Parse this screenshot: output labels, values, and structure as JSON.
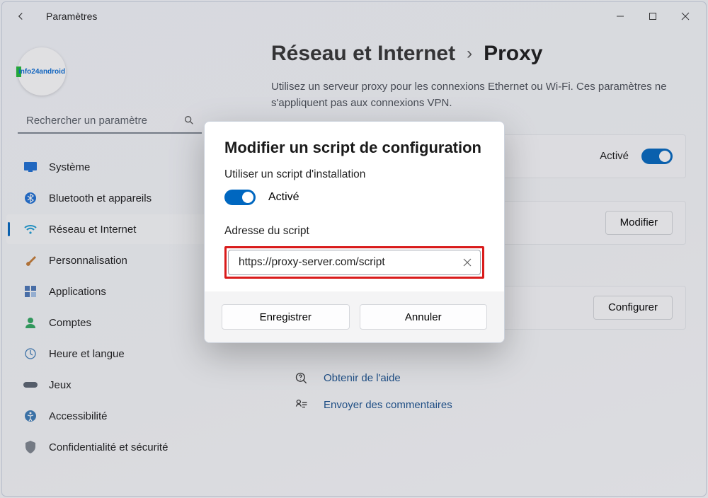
{
  "titlebar": {
    "title": "Paramètres"
  },
  "avatar_logo_text": "info24android",
  "search": {
    "placeholder": "Rechercher un paramètre"
  },
  "sidebar": {
    "items": [
      {
        "label": "Système"
      },
      {
        "label": "Bluetooth et appareils"
      },
      {
        "label": "Réseau et Internet"
      },
      {
        "label": "Personnalisation"
      },
      {
        "label": "Applications"
      },
      {
        "label": "Comptes"
      },
      {
        "label": "Heure et langue"
      },
      {
        "label": "Jeux"
      },
      {
        "label": "Accessibilité"
      },
      {
        "label": "Confidentialité et sécurité"
      }
    ]
  },
  "breadcrumb": {
    "parent": "Réseau et Internet",
    "leaf": "Proxy"
  },
  "description": "Utilisez un serveur proxy pour les connexions Ethernet ou Wi-Fi. Ces paramètres ne s'appliquent pas aux connexions VPN.",
  "cards": {
    "c1_state": "Activé",
    "c2_btn": "Modifier",
    "c3_btn": "Configurer"
  },
  "links": {
    "help": "Obtenir de l'aide",
    "feedback": "Envoyer des commentaires"
  },
  "dialog": {
    "title": "Modifier un script de configuration",
    "subtitle": "Utiliser un script d'installation",
    "toggle_label": "Activé",
    "field_label": "Adresse du script",
    "field_value": "https://proxy-server.com/script",
    "save": "Enregistrer",
    "cancel": "Annuler"
  }
}
